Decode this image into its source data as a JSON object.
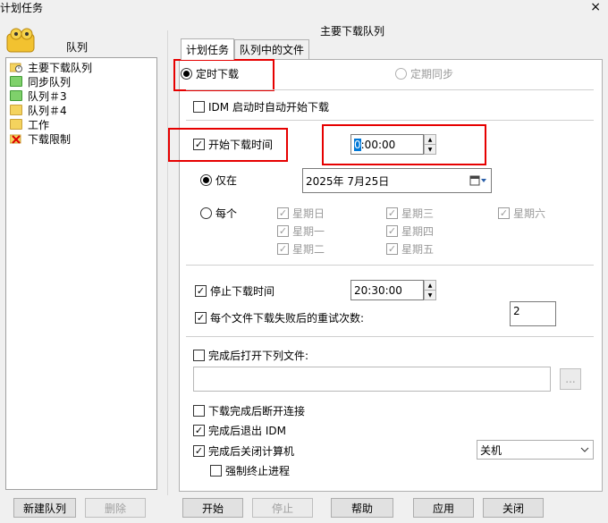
{
  "window": {
    "title": "计划任务",
    "close_glyph": "×"
  },
  "queue_panel": {
    "header": "队列",
    "items": [
      {
        "label": "主要下载队列",
        "icon": "main-queue-icon"
      },
      {
        "label": "同步队列",
        "icon": "green-folder-icon"
      },
      {
        "label": "队列＃3",
        "icon": "green-folder-icon"
      },
      {
        "label": "队列＃4",
        "icon": "folder-icon"
      },
      {
        "label": "工作",
        "icon": "folder-icon"
      },
      {
        "label": "下载限制",
        "icon": "limit-icon"
      }
    ],
    "new_queue": "新建队列",
    "delete": "删除"
  },
  "main": {
    "title": "主要下载队列",
    "tabs": [
      "计划任务",
      "队列中的文件"
    ],
    "timed_download": "定时下载",
    "periodic_sync": "定期同步",
    "start_on_idm_launch": "IDM 启动时自动开始下载",
    "start_time_label": "开始下载时间",
    "start_time_sel": "0",
    "start_time_rest": ":00:00",
    "only_on": "仅在",
    "date_value": "2025年 7月25日",
    "every": "每个",
    "days": [
      "星期日",
      "星期一",
      "星期二",
      "星期三",
      "星期四",
      "星期五",
      "星期六"
    ],
    "stop_time_label": "停止下载时间",
    "stop_time_value": "20:30:00",
    "retry_label": "每个文件下载失败后的重试次数:",
    "retry_value": "2",
    "open_file_label": "完成后打开下列文件:",
    "browse": "...",
    "disconnect": "下载完成后断开连接",
    "exit_idm": "完成后退出 IDM",
    "shutdown": "完成后关闭计算机",
    "shutdown_option": "关机",
    "force_terminate": "强制终止进程"
  },
  "footer": {
    "start": "开始",
    "stop": "停止",
    "help": "帮助",
    "apply": "应用",
    "close": "关闭"
  },
  "colors": {
    "highlight_box": "#e60000",
    "selection": "#0078d7"
  }
}
